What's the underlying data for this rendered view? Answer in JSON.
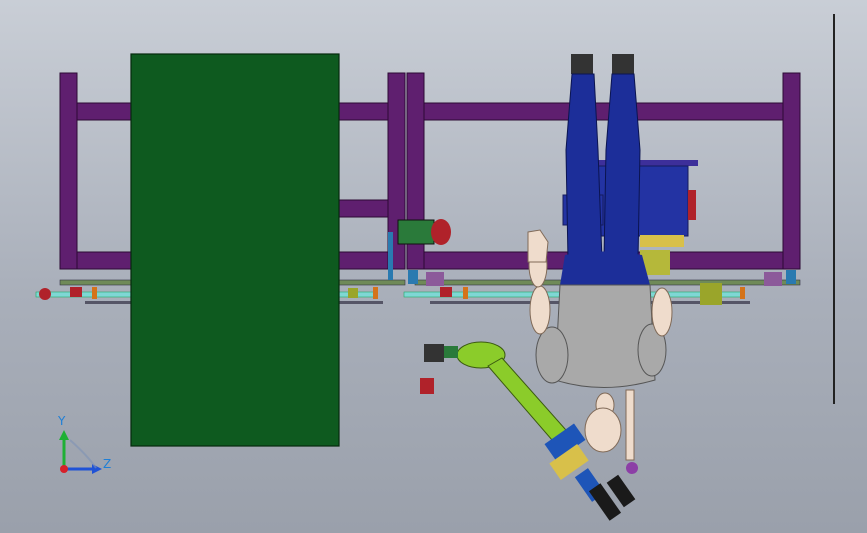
{
  "viewport": {
    "background_top": "#c9ced6",
    "background_bottom": "#9aa0ab"
  },
  "colors": {
    "frame": "#5f1f6f",
    "frame_edge": "#2c0a34",
    "panel": "#0e5a1f",
    "rail": "#6f8a58",
    "shaft": "#7fd7d4",
    "red_part": "#b0222a",
    "orange_part": "#d4731a",
    "blue_pants": "#1c2e99",
    "torso": "#a9a9a9",
    "skin": "#efdccc",
    "robot_arm": "#8bcc2a",
    "robot_blue": "#1e55b8",
    "motor_blue": "#2333a3"
  },
  "icons": {
    "human_mannequin": "human-mannequin-icon",
    "robot_arm": "robot-arm-icon",
    "axis_triad": "axis-triad-icon"
  },
  "triad": {
    "y_label": "Y",
    "z_label": "Z",
    "y_color": "#1fb035",
    "z_color": "#1f52d6",
    "origin_color": "#d6202a"
  }
}
